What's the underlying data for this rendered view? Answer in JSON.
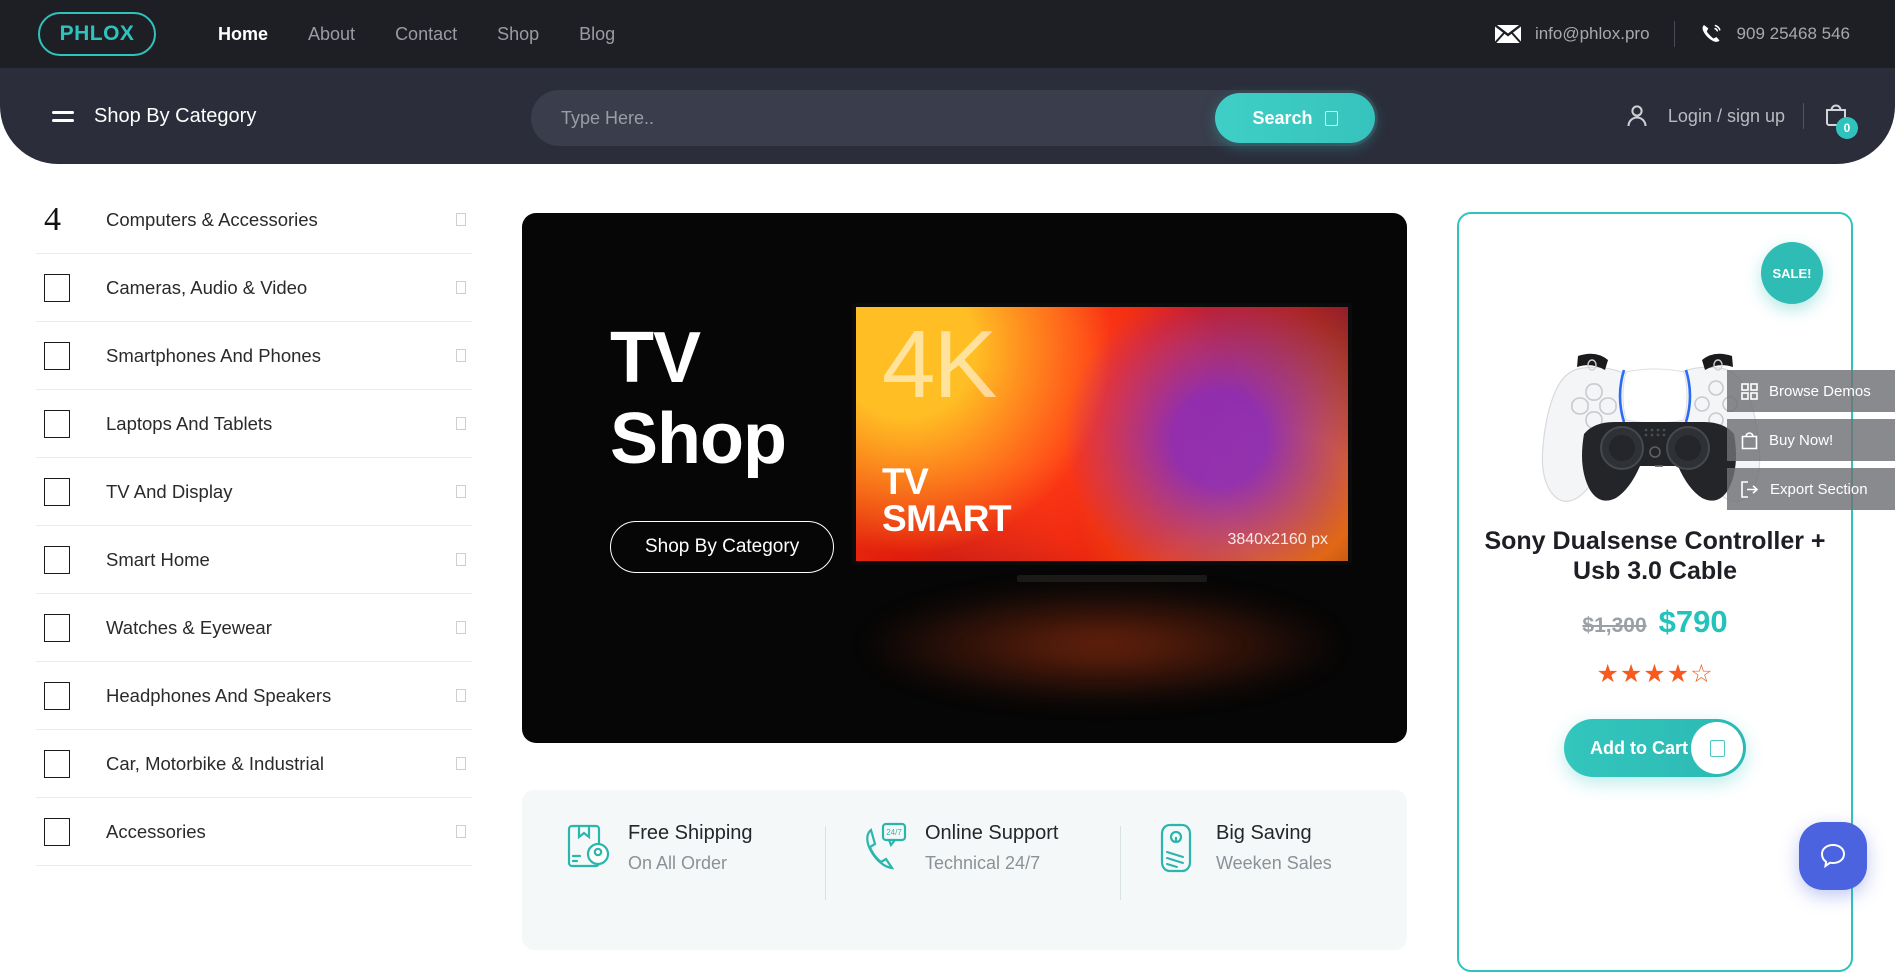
{
  "brand": {
    "logo_text": "PHLOX"
  },
  "mainnav": {
    "items": [
      {
        "label": "Home",
        "active": true
      },
      {
        "label": "About",
        "active": false
      },
      {
        "label": "Contact",
        "active": false
      },
      {
        "label": "Shop",
        "active": false
      },
      {
        "label": "Blog",
        "active": false
      }
    ]
  },
  "contact": {
    "email": "info@phlox.pro",
    "phone": "909 25468 546",
    "email_icon": "envelope-icon",
    "phone_icon": "phone-icon"
  },
  "searchbar": {
    "category_label": "Shop By Category",
    "menu_icon": "hamburger-icon",
    "placeholder": "Type Here..",
    "value": "",
    "search_label": "Search",
    "search_icon": "box-glyph-icon"
  },
  "account": {
    "login_label": "Login / sign up",
    "user_icon": "user-icon",
    "cart_icon": "shopping-bag-icon",
    "cart_count": "0"
  },
  "sidebar": {
    "items": [
      {
        "label": "Computers & Accessories",
        "marker": "4",
        "marker_type": "glyph"
      },
      {
        "label": "Cameras, Audio & Video",
        "marker": "",
        "marker_type": "box"
      },
      {
        "label": "Smartphones And Phones",
        "marker": "",
        "marker_type": "box"
      },
      {
        "label": "Laptops And Tablets",
        "marker": "",
        "marker_type": "box"
      },
      {
        "label": "TV And Display",
        "marker": "",
        "marker_type": "box"
      },
      {
        "label": "Smart Home",
        "marker": "",
        "marker_type": "box"
      },
      {
        "label": "Watches & Eyewear",
        "marker": "",
        "marker_type": "box"
      },
      {
        "label": "Headphones And Speakers",
        "marker": "",
        "marker_type": "box"
      },
      {
        "label": "Car, Motorbike & Industrial",
        "marker": "",
        "marker_type": "box"
      },
      {
        "label": "Accessories",
        "marker": "",
        "marker_type": "box"
      }
    ]
  },
  "hero": {
    "line1": "TV",
    "line2": "Shop",
    "button_label": "Shop By Category",
    "tv": {
      "resolution_tag": "4K",
      "smart_line1": "TV",
      "smart_line2": "SMART",
      "resolution_px": "3840x2160 px"
    }
  },
  "features": [
    {
      "title": "Free Shipping",
      "subtitle": "On All Order",
      "icon": "package-location-icon"
    },
    {
      "title": "Online Support",
      "subtitle": "Technical 24/7",
      "icon": "phone-247-icon"
    },
    {
      "title": "Big Saving",
      "subtitle": "Weeken Sales",
      "icon": "price-tag-icon"
    }
  ],
  "product": {
    "badge": "SALE!",
    "name": "Sony Dualsense Controller + Usb 3.0 Cable",
    "old_price": "$1,300",
    "new_price": "$790",
    "rating": 4,
    "rating_max": 5,
    "stars_display": "★★★★☆",
    "add_to_cart_label": "Add to Cart",
    "add_to_cart_icon": "box-glyph-icon",
    "image_alt": "playstation-dualsense-controller"
  },
  "overlay_menu": {
    "items": [
      {
        "label": "Browse Demos",
        "icon": "grid-icon"
      },
      {
        "label": "Buy Now!",
        "icon": "shopping-bag-icon"
      },
      {
        "label": "Export Section",
        "icon": "export-arrow-icon"
      }
    ]
  },
  "chat": {
    "icon": "chat-bubble-icon"
  },
  "colors": {
    "accent_teal": "#2ec4bd",
    "header_dark": "#1e1f24",
    "searchrow_dark": "#2b2d3a",
    "star_orange": "#f8591e",
    "chat_blue": "#4b63de"
  }
}
